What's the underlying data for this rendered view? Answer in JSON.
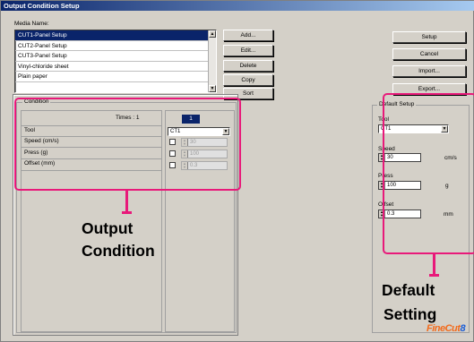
{
  "window": {
    "title": "Output Condition Setup"
  },
  "media": {
    "label": "Media Name:",
    "items": [
      {
        "label": "CUT1-Panel Setup",
        "selected": true
      },
      {
        "label": "CUT2-Panel Setup",
        "selected": false
      },
      {
        "label": "CUT3-Panel Setup",
        "selected": false
      },
      {
        "label": "Vinyl-chloride sheet",
        "selected": false
      },
      {
        "label": "Plain paper",
        "selected": false
      }
    ]
  },
  "media_buttons": {
    "add": "Add...",
    "edit": "Edit...",
    "delete": "Delete",
    "copy": "Copy",
    "sort": "Sort"
  },
  "right_buttons": {
    "setup": "Setup",
    "cancel": "Cancel",
    "import": "Import...",
    "export": "Export..."
  },
  "condition": {
    "title": "Condition",
    "times_label": "Times : 1",
    "column_number": "1",
    "rows": {
      "tool": "Tool",
      "speed": "Speed (cm/s)",
      "press": "Press (g)",
      "offset": "Offset (mm)"
    },
    "tool_value": "CT1",
    "speed_value": "30",
    "press_value": "100",
    "offset_value": "0.3"
  },
  "default_setup": {
    "title": "Default Setup",
    "tool_label": "Tool",
    "tool_value": "CT1",
    "speed_label": "Speed",
    "speed_value": "30",
    "speed_unit": "cm/s",
    "press_label": "Press",
    "press_value": "100",
    "press_unit": "g",
    "offset_label": "Offset",
    "offset_value": "0.3",
    "offset_unit": "mm"
  },
  "annotations": {
    "output_line1": "Output",
    "output_line2": "Condition",
    "default_line1": "Default",
    "default_line2": "Setting"
  },
  "logo": {
    "text": "FineCut",
    "number": "8"
  },
  "colors": {
    "highlight": "#e8197a",
    "selection": "#0a246a",
    "title_bar": "#0a246a",
    "logo_orange": "#f26b1d",
    "logo_blue": "#1d5fd6"
  }
}
